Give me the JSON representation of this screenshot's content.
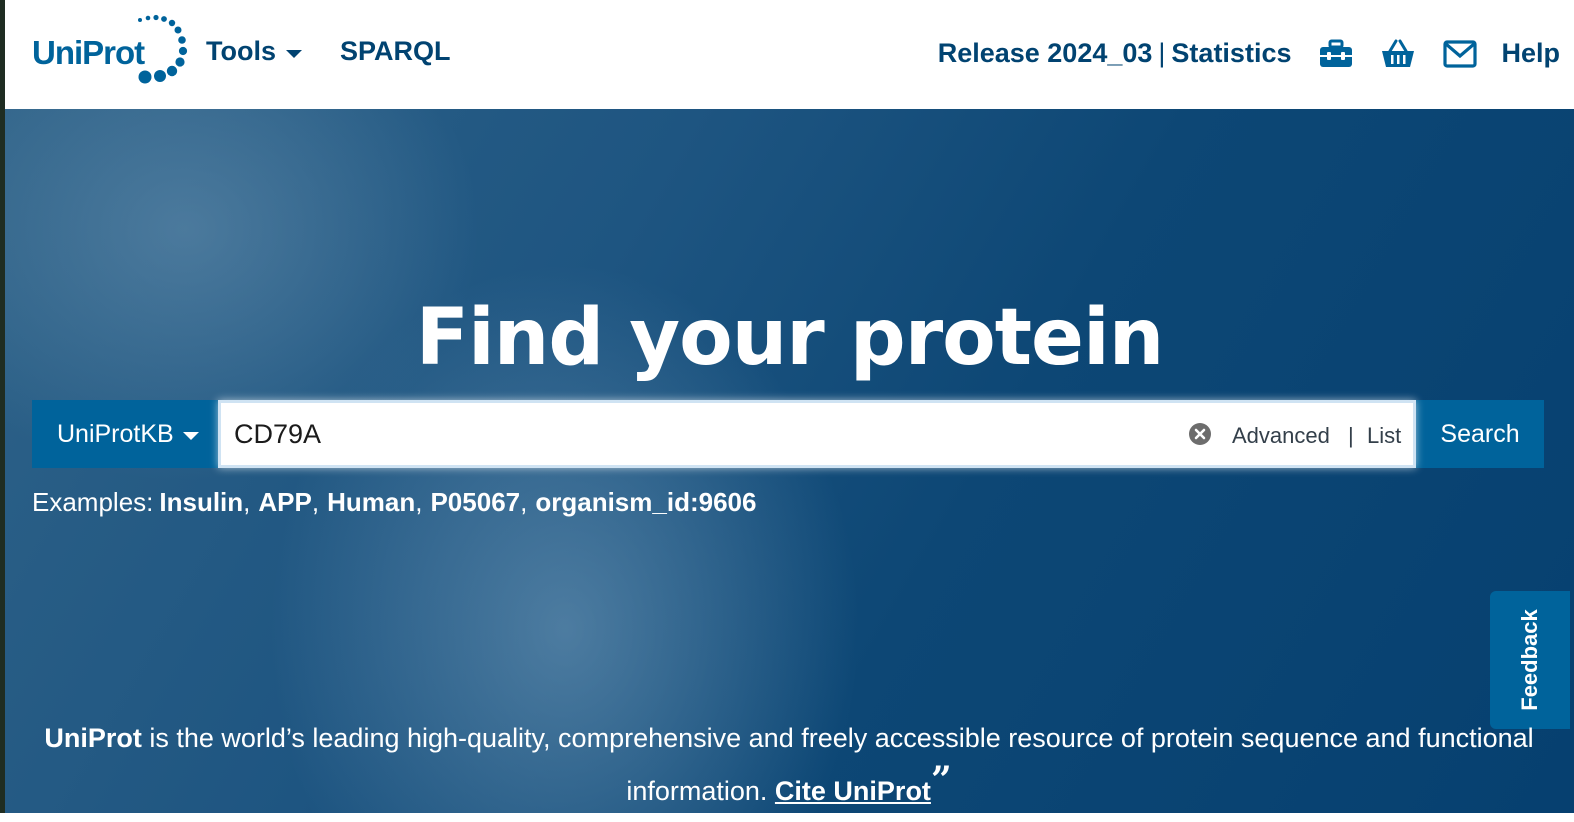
{
  "header": {
    "logo_text": "UniProt",
    "nav": [
      {
        "label": "Tools"
      },
      {
        "label": "SPARQL"
      }
    ],
    "release": "Release 2024_03",
    "separator": "|",
    "statistics": "Statistics",
    "icons": [
      "toolkit-icon",
      "basket-icon",
      "mail-icon"
    ],
    "help": "Help"
  },
  "hero": {
    "title": "Find your protein",
    "database_select": "UniProtKB",
    "search": {
      "value": "CD79A",
      "advanced_label": "Advanced",
      "separator": "|",
      "list_label": "List",
      "button_label": "Search"
    },
    "examples": {
      "label": "Examples:",
      "items": [
        "Insulin",
        "APP",
        "Human",
        "P05067",
        "organism_id:9606"
      ]
    },
    "feedback_label": "Feedback",
    "tagline": {
      "brand": "UniProt",
      "text": " is the world’s leading high-quality, comprehensive and freely accessible resource of protein sequence and functional information. ",
      "cite_label": "Cite UniProt",
      "quote_glyph": "”"
    }
  },
  "colors": {
    "brand_blue": "#00639b",
    "nav_text": "#014371",
    "hero_dark": "#064070"
  }
}
